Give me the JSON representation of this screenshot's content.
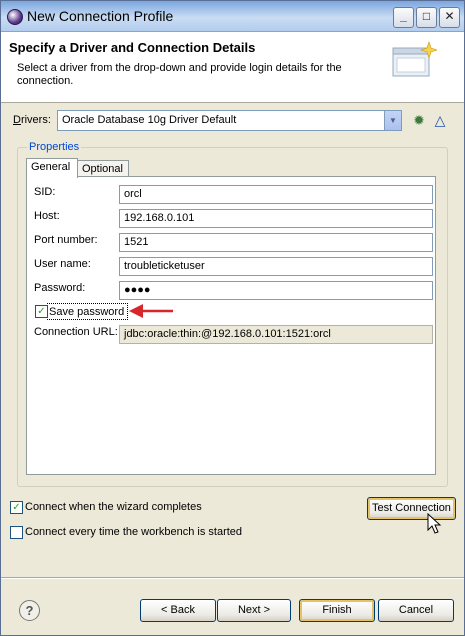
{
  "window": {
    "title": "New Connection Profile",
    "controls": {
      "minimize": "_",
      "maximize": "□",
      "close": "✕"
    }
  },
  "banner": {
    "title": "Specify a Driver and Connection Details",
    "description": "Select a driver from the drop-down and provide login details for the connection."
  },
  "drivers": {
    "label_prefix": "D",
    "label_rest": "rivers:",
    "selected": "Oracle Database 10g Driver Default",
    "icons": [
      "add-driver-icon",
      "edit-driver-icon"
    ]
  },
  "properties": {
    "legend": "Properties",
    "tabs": [
      {
        "label": "General",
        "active": true
      },
      {
        "label": "Optional",
        "active": false
      }
    ],
    "fields": [
      {
        "label": "SID:",
        "value": "orcl"
      },
      {
        "label": "Host:",
        "value": "192.168.0.101"
      },
      {
        "label": "Port number:",
        "value": "1521"
      },
      {
        "label": "User name:",
        "value": "troubleticketuser"
      },
      {
        "label": "Password:",
        "value": "●●●●"
      }
    ],
    "save_password": {
      "label": "Save password",
      "checked": true
    },
    "connection_url": {
      "label": "Connection URL:",
      "value": "jdbc:oracle:thin:@192.168.0.101:1521:orcl"
    }
  },
  "options": {
    "connect_when_complete": {
      "label": "Connect when the wizard completes",
      "checked": true
    },
    "connect_every_time": {
      "label": "Connect every time the workbench is started",
      "checked": false
    }
  },
  "buttons": {
    "test": "Test Connection",
    "back": "< Back",
    "next": "Next >",
    "finish": "Finish",
    "cancel": "Cancel",
    "help": "?"
  },
  "colors": {
    "accent": "#0046d5",
    "annotation_arrow": "#d9262a",
    "check": "#21a121"
  }
}
